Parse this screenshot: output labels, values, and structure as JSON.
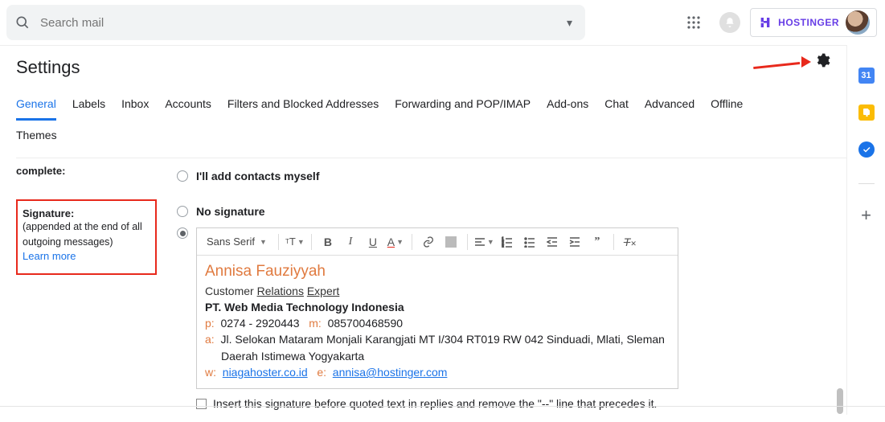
{
  "search": {
    "placeholder": "Search mail"
  },
  "brand": {
    "label": "HOSTINGER"
  },
  "page": {
    "title": "Settings"
  },
  "tabs": {
    "row1": [
      "General",
      "Labels",
      "Inbox",
      "Accounts",
      "Filters and Blocked Addresses",
      "Forwarding and POP/IMAP",
      "Add-ons",
      "Chat",
      "Advanced",
      "Offline"
    ],
    "row2": [
      "Themes"
    ]
  },
  "complete_label": "complete:",
  "signature_section": {
    "title": "Signature:",
    "desc": "(appended at the end of all outgoing messages)",
    "learn": "Learn more"
  },
  "contacts_option": "I'll add contacts myself",
  "nosig_option": "No signature",
  "editor": {
    "font": "Sans Serif"
  },
  "signature_data": {
    "name": "Annisa Fauziyyah",
    "job_a": "Customer",
    "job_b": "Relations",
    "job_c": "Expert",
    "company": "PT. Web Media Technology Indonesia",
    "p_label": "p:",
    "phone": "0274 - 2920443",
    "m_label": "m:",
    "mobile": "085700468590",
    "a_label": "a:",
    "addr1": "Jl. Selokan Mataram Monjali Karangjati MT I/304 RT019 RW 042 Sinduadi, Mlati, Sleman",
    "addr2": "Daerah Istimewa Yogyakarta",
    "w_label": "w:",
    "web": "niagahoster.co.id",
    "e_label": "e:",
    "email": "annisa@hostinger.com"
  },
  "insert_text": "Insert this signature before quoted text in replies and remove the \"--\" line that precedes it.",
  "side_panel": {
    "cal": "31"
  }
}
